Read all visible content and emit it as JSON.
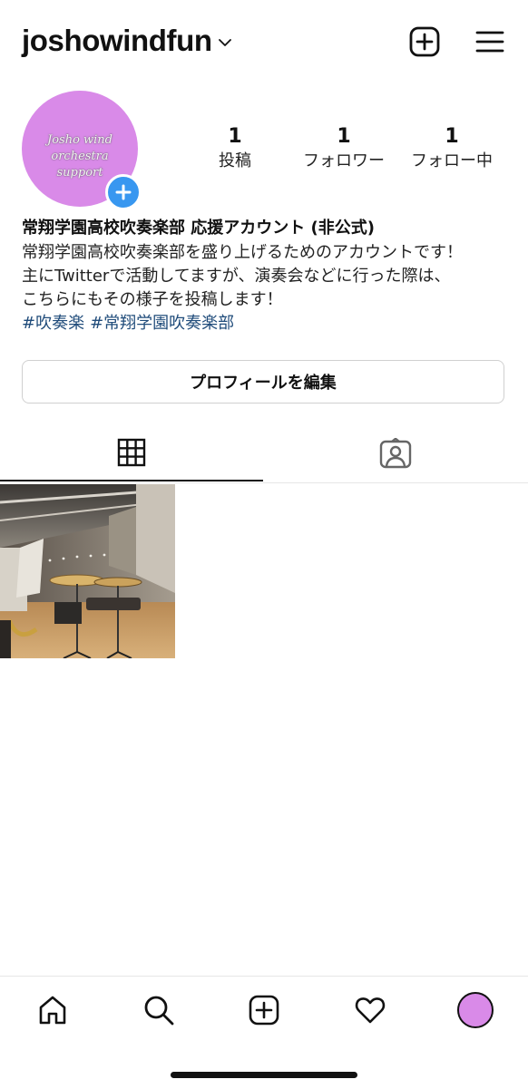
{
  "header": {
    "username": "joshowindfun",
    "icons": [
      "chevron-down-icon",
      "new-post-icon",
      "menu-icon"
    ]
  },
  "profile": {
    "avatar_text_line1": "Josho wind orchestra",
    "avatar_text_line2": "support",
    "stats": [
      {
        "count": "1",
        "label": "投稿"
      },
      {
        "count": "1",
        "label": "フォロワー"
      },
      {
        "count": "1",
        "label": "フォロー中"
      }
    ],
    "display_name": "常翔学園高校吹奏楽部 応援アカウント (非公式)",
    "bio_lines": [
      "常翔学園高校吹奏楽部を盛り上げるためのアカウントです！",
      "主にTwitterで活動してますが、演奏会などに行った際は、",
      "こちらにもその様子を投稿します！"
    ],
    "hashtags": [
      "#吹奏楽",
      "#常翔学園吹奏楽部"
    ],
    "edit_button_label": "プロフィールを編集"
  },
  "tabs": [
    {
      "icon": "grid-icon",
      "selected": true
    },
    {
      "icon": "tagged-person-icon",
      "selected": false
    }
  ],
  "bottom_nav": [
    "home-icon",
    "search-icon",
    "create-icon",
    "heart-icon",
    "profile-avatar"
  ],
  "colors": {
    "avatar_bg": "#d98ae8",
    "add_badge": "#3897f0",
    "hashtag": "#1f4b7a"
  }
}
